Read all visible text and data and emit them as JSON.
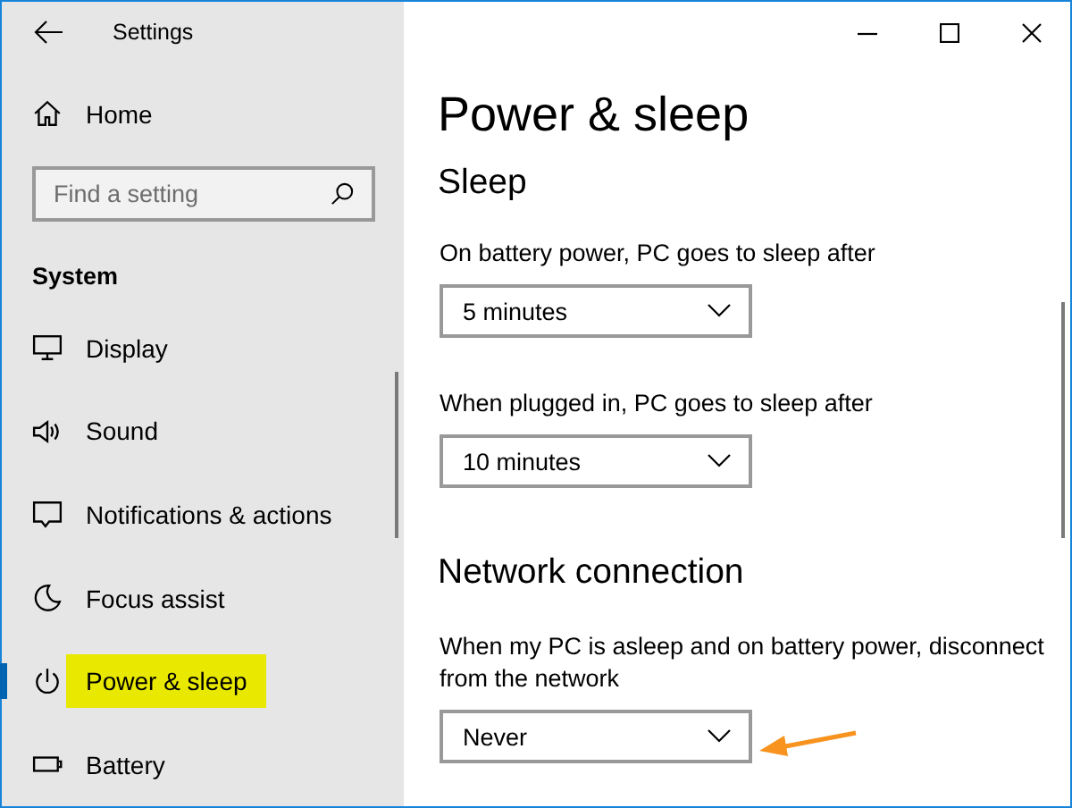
{
  "window": {
    "title": "Settings"
  },
  "sidebar": {
    "home": "Home",
    "search": {
      "placeholder": "Find a setting"
    },
    "section": "System",
    "items": [
      {
        "kind": "display",
        "label": "Display",
        "selected": false,
        "highlighted": false
      },
      {
        "kind": "sound",
        "label": "Sound",
        "selected": false,
        "highlighted": false
      },
      {
        "kind": "notifications",
        "label": "Notifications & actions",
        "selected": false,
        "highlighted": false
      },
      {
        "kind": "focus",
        "label": "Focus assist",
        "selected": false,
        "highlighted": false
      },
      {
        "kind": "power",
        "label": "Power & sleep",
        "selected": true,
        "highlighted": true
      },
      {
        "kind": "battery",
        "label": "Battery",
        "selected": false,
        "highlighted": false
      }
    ]
  },
  "page": {
    "title": "Power & sleep",
    "sections": [
      {
        "heading": "Sleep",
        "settings": [
          {
            "label": "On battery power, PC goes to sleep after",
            "value": "5 minutes",
            "arrow": false
          },
          {
            "label": "When plugged in, PC goes to sleep after",
            "value": "10 minutes",
            "arrow": false
          }
        ]
      },
      {
        "heading": "Network connection",
        "settings": [
          {
            "label": "When my PC is asleep and on battery power, disconnect from the network",
            "value": "Never",
            "arrow": true
          }
        ]
      }
    ]
  }
}
